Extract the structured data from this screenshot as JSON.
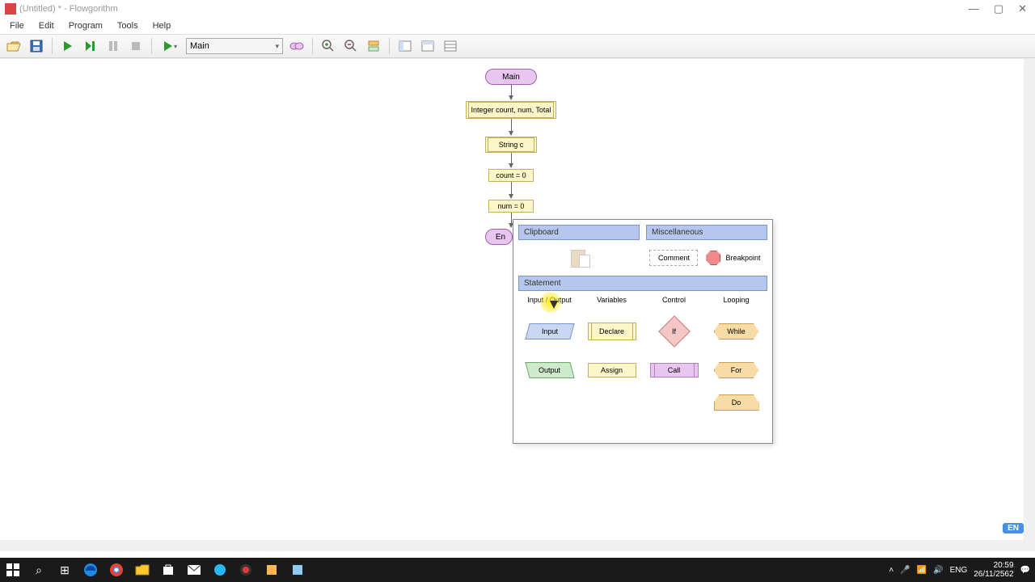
{
  "titlebar": {
    "title": "(Untitled) * - Flowgorithm"
  },
  "menu": {
    "file": "File",
    "edit": "Edit",
    "program": "Program",
    "tools": "Tools",
    "help": "Help"
  },
  "toolbar": {
    "function_selector": "Main"
  },
  "flowchart": {
    "start": "Main",
    "decl1": "Integer count, num, Total",
    "decl2": "String c",
    "assign1": "count = 0",
    "assign2": "num = 0",
    "end": "En"
  },
  "popup": {
    "clipboard_header": "Clipboard",
    "misc_header": "Miscellaneous",
    "comment": "Comment",
    "breakpoint": "Breakpoint",
    "statement_header": "Statement",
    "cat_io": "Input / Output",
    "cat_vars": "Variables",
    "cat_ctrl": "Control",
    "cat_loop": "Looping",
    "input": "Input",
    "output": "Output",
    "declare": "Declare",
    "assign": "Assign",
    "if": "If",
    "call": "Call",
    "while": "While",
    "for": "For",
    "do": "Do"
  },
  "langbadge": "EN",
  "taskbar": {
    "lang": "ENG",
    "time": "20:59",
    "date": "26/11/2562"
  }
}
